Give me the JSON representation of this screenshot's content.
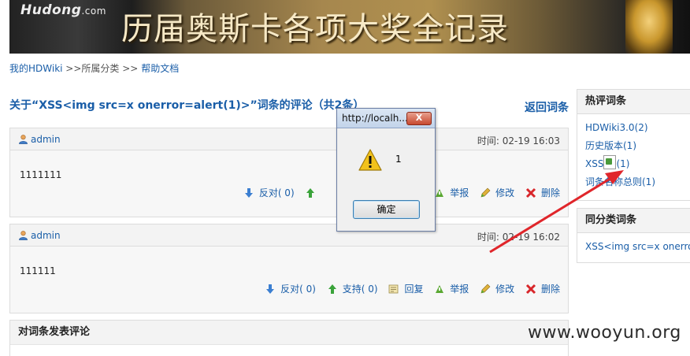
{
  "banner": {
    "logo_main": "Hudong",
    "logo_suffix": ".com",
    "title": "历届奥斯卡各项大奖全记录"
  },
  "breadcrumb": {
    "home": "我的HDWiki",
    "sep1": " >>",
    "category": "所属分类",
    "sep2": " >> ",
    "help": "帮助文档"
  },
  "main": {
    "heading": "关于“XSS<img src=x onerror=alert(1)>”词条的评论（共2条）",
    "back_label": "返回词条",
    "comments": [
      {
        "user": "admin",
        "time": "时间: 02-19 16:03",
        "text": "1111111",
        "against": "反对( 0)",
        "support": "",
        "reply": "",
        "report": "举报",
        "edit": "修改",
        "delete": "删除"
      },
      {
        "user": "admin",
        "time": "时间: 02-19 16:02",
        "text": "111111",
        "against": "反对( 0)",
        "support": "支持( 0)",
        "reply": "回复",
        "report": "举报",
        "edit": "修改",
        "delete": "删除"
      }
    ],
    "form_title": "对词条发表评论"
  },
  "sidebar": {
    "hot_title": "热评词条",
    "hot_items": [
      "HDWiki3.0(2)",
      "历史版本(1)",
      "XSS",
      "(1)",
      "词条名称总则(1)"
    ],
    "same_title": "同分类词条",
    "same_items": [
      "XSS<img src=x onerror"
    ]
  },
  "dialog": {
    "title": "http://localh...",
    "close": "X",
    "message": "1",
    "ok_label": "确定"
  },
  "watermark": "www.wooyun.org",
  "colors": {
    "link": "#1a5ea8",
    "arrow": "#e0262b",
    "panel_head": "#f3f3f3"
  }
}
